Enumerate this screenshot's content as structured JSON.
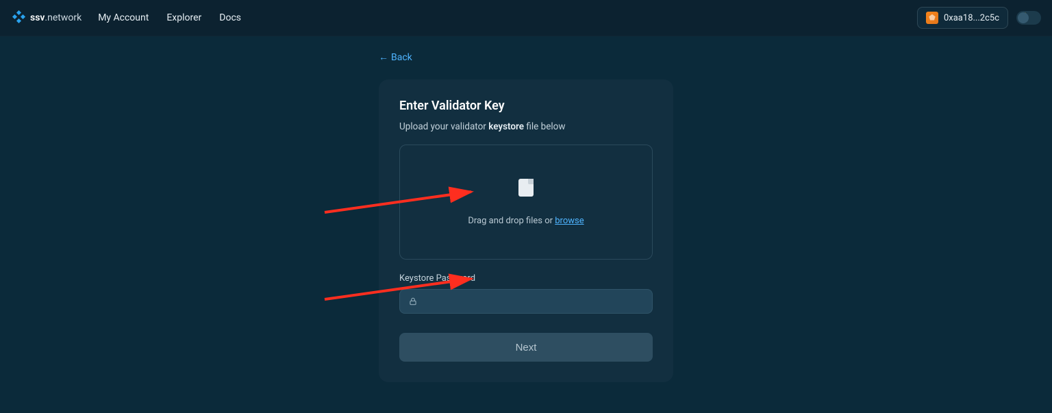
{
  "brand": {
    "bold": "ssv",
    "light": ".network"
  },
  "nav": {
    "my_account": "My Account",
    "explorer": "Explorer",
    "docs": "Docs"
  },
  "wallet": {
    "address": "0xaa18...2c5c"
  },
  "back": "Back",
  "card": {
    "title": "Enter Validator Key",
    "sub_prefix": "Upload your validator ",
    "sub_bold": "keystore",
    "sub_suffix": " file below",
    "drop_text": "Drag and drop files or ",
    "browse": "browse",
    "password_label": "Keystore Password",
    "password_value": "",
    "next": "Next"
  }
}
